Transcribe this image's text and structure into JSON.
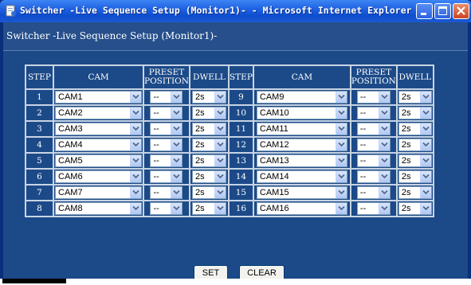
{
  "window": {
    "title": "Switcher -Live Sequence Setup (Monitor1)- - Microsoft Internet Explorer"
  },
  "page": {
    "title": "Switcher -Live Sequence Setup (Monitor1)-"
  },
  "table": {
    "headers": {
      "step": "STEP",
      "cam": "CAM",
      "preset_line1": "PRESET",
      "preset_line2": "POSITION",
      "dwell": "DWELL"
    },
    "left_rows": [
      {
        "step": "1",
        "cam": "CAM1",
        "preset": "--",
        "dwell": "2s"
      },
      {
        "step": "2",
        "cam": "CAM2",
        "preset": "--",
        "dwell": "2s"
      },
      {
        "step": "3",
        "cam": "CAM3",
        "preset": "--",
        "dwell": "2s"
      },
      {
        "step": "4",
        "cam": "CAM4",
        "preset": "--",
        "dwell": "2s"
      },
      {
        "step": "5",
        "cam": "CAM5",
        "preset": "--",
        "dwell": "2s"
      },
      {
        "step": "6",
        "cam": "CAM6",
        "preset": "--",
        "dwell": "2s"
      },
      {
        "step": "7",
        "cam": "CAM7",
        "preset": "--",
        "dwell": "2s"
      },
      {
        "step": "8",
        "cam": "CAM8",
        "preset": "--",
        "dwell": "2s"
      }
    ],
    "right_rows": [
      {
        "step": "9",
        "cam": "CAM9",
        "preset": "--",
        "dwell": "2s"
      },
      {
        "step": "10",
        "cam": "CAM10",
        "preset": "--",
        "dwell": "2s"
      },
      {
        "step": "11",
        "cam": "CAM11",
        "preset": "--",
        "dwell": "2s"
      },
      {
        "step": "12",
        "cam": "CAM12",
        "preset": "--",
        "dwell": "2s"
      },
      {
        "step": "13",
        "cam": "CAM13",
        "preset": "--",
        "dwell": "2s"
      },
      {
        "step": "14",
        "cam": "CAM14",
        "preset": "--",
        "dwell": "2s"
      },
      {
        "step": "15",
        "cam": "CAM15",
        "preset": "--",
        "dwell": "2s"
      },
      {
        "step": "16",
        "cam": "CAM16",
        "preset": "--",
        "dwell": "2s"
      }
    ]
  },
  "buttons": {
    "set": "SET",
    "clear": "CLEAR"
  },
  "colors": {
    "titlebar": "#1f61e0",
    "background": "#1c4a88",
    "close": "#cc4420"
  },
  "icons": {
    "app": "ie-page-icon",
    "minimize": "minimize-icon",
    "maximize": "maximize-icon",
    "close": "close-icon",
    "dropdown": "chevron-down-icon"
  }
}
